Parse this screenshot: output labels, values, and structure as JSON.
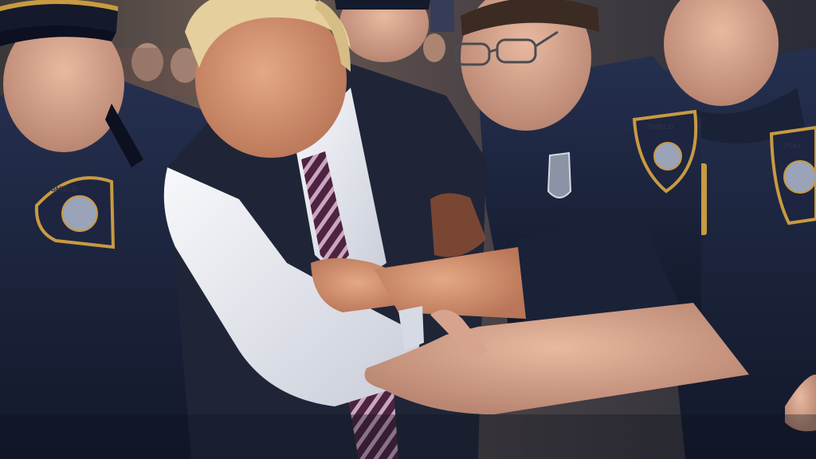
{
  "image": {
    "kind": "photo-realistic scene",
    "colors": {
      "uniform_navy": "#1d2540",
      "uniform_shadow": "#121829",
      "suit_navy": "#1f2537",
      "shirt_white": "#eef0f5",
      "tie_stripe_a": "#5b2a4a",
      "tie_stripe_b": "#c9a7c0",
      "skin": "#d99a78",
      "hair_blond": "#e5cf9c",
      "badge_gold": "#c89a42",
      "background_crowd": "#6b5a52"
    },
    "badge_text": [
      "SHIELD",
      "POLICE"
    ]
  }
}
